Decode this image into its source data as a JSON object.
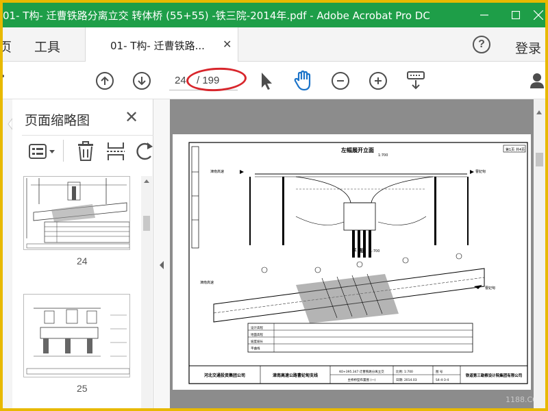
{
  "window": {
    "title": "01- T构- 迁曹铁路分离立交 转体桥 (55+55) -铁三院-2014年.pdf - Adobe Acrobat Pro DC",
    "minimize_icon": "minimize-icon",
    "maximize_icon": "maximize-icon",
    "close_icon": "close-icon"
  },
  "tabs": {
    "home_label": "页",
    "tools_label": "工具",
    "doc_label": "01- T构- 迁曹铁路...",
    "help_label": "?",
    "login_label": "登录"
  },
  "toolbar": {
    "page_current": "24",
    "page_total": "/ 199"
  },
  "sidebar": {
    "title": "页面缩略图",
    "thumbnails": [
      {
        "page": "24"
      },
      {
        "page": "25"
      }
    ]
  },
  "drawing": {
    "title": "左幅展开立面",
    "scale_top": "1:700",
    "sheet_no": "第1页",
    "sheet_total": "共4页",
    "label_left_top": "津南高速",
    "label_right_top": "曹妃甸",
    "plan_label": "平 面",
    "plan_scale": "1:700",
    "label_left_plan": "津南高速",
    "label_right_plan": "曹妃甸",
    "company": "河北交通投资集团公司",
    "project": "津南高速公路曹妃甸支线",
    "drawing_name": "K0+395.347 迁曹铁路分离立交",
    "drawing_sub": "主桥桥型布置图 (一)",
    "scale_label": "比例: 1:700",
    "fig_label": "图 号",
    "date_label": "日期: 2014.03",
    "fig_no": "S4-4-3-4",
    "designer": "铁道第三勘察设计院集团有限公司",
    "row_labels": [
      "设计高程",
      "地面高程",
      "坡度坡长",
      "平曲线"
    ],
    "watermark": "1188.COM"
  }
}
